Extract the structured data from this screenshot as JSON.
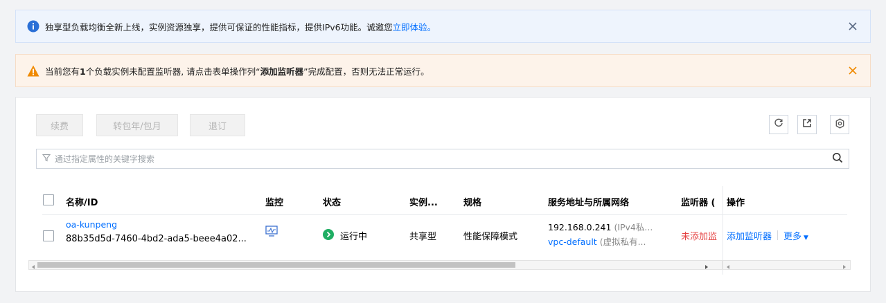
{
  "banners": {
    "info": {
      "text": "独享型负载均衡全新上线，实例资源独享，提供可保证的性能指标，提供IPv6功能。诚邀您",
      "link": "立即体验。"
    },
    "warn": {
      "text_before": "当前您有",
      "count": "1",
      "text_mid": "个负载实例未配置监听器, 请点击表单操作列“",
      "action": "添加监听器",
      "text_after": "”完成配置，否则无法正常运行。"
    }
  },
  "toolbar": {
    "renew": "续费",
    "convert": "转包年/包月",
    "unsubscribe": "退订"
  },
  "search": {
    "placeholder": "通过指定属性的关键字搜索"
  },
  "table": {
    "headers": {
      "name": "名称/ID",
      "monitor": "监控",
      "status": "状态",
      "instance": "实例...",
      "spec": "规格",
      "address": "服务地址与所属网络",
      "listener": "监听器 (",
      "ops": "操作"
    },
    "rows": [
      {
        "name": "oa-kunpeng",
        "id": "88b35d5d-7460-4bd2-ada5-beee4a02...",
        "status": "运行中",
        "instance_type": "共享型",
        "spec": "性能保障模式",
        "ip": "192.168.0.241",
        "ip_note": "(IPv4私...",
        "vpc": "vpc-default",
        "vpc_note": "(虚拟私有...",
        "listener": "未添加监",
        "op_add": "添加监听器",
        "op_more": "更多"
      }
    ]
  },
  "colors": {
    "link": "#006eff",
    "info_icon": "#2a6fd6",
    "warn_icon": "#f08a00",
    "status_running": "#1fae63",
    "listener_missing": "#e54545"
  }
}
